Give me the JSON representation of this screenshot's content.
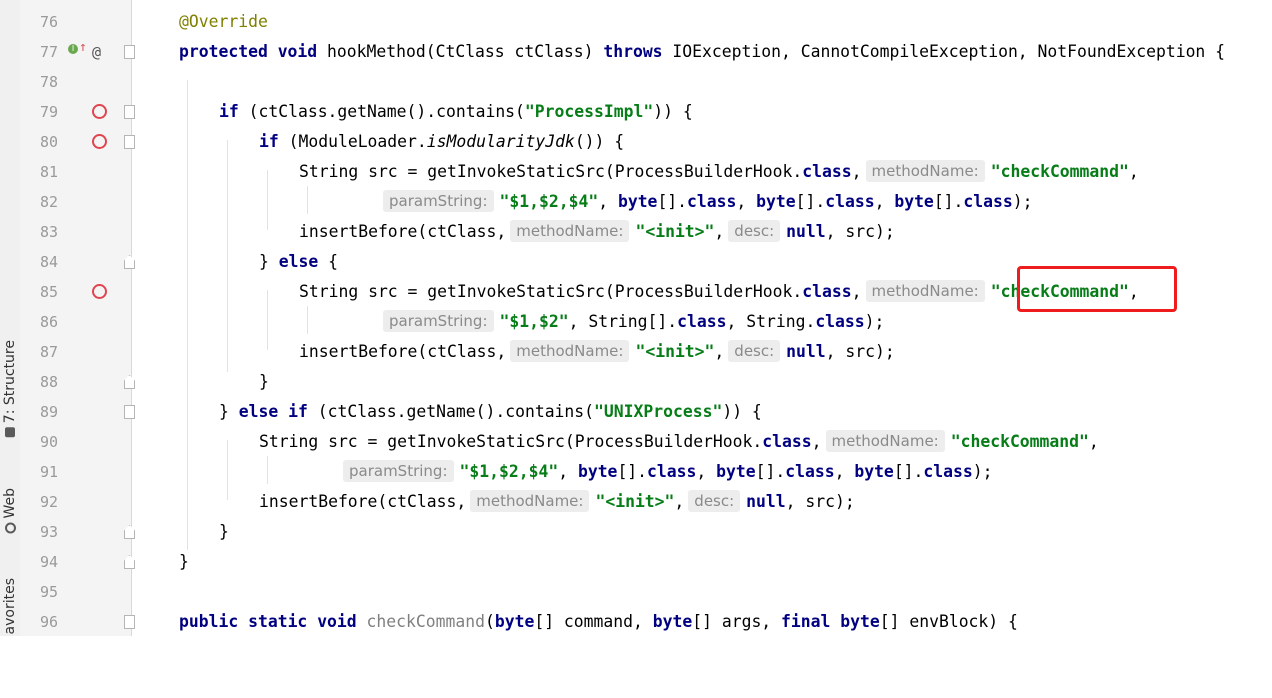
{
  "side_tabs": {
    "structure": "7: Structure",
    "web": "Web",
    "favorites": "avorites"
  },
  "lines": [
    {
      "num": "76"
    },
    {
      "num": "77"
    },
    {
      "num": "78"
    },
    {
      "num": "79"
    },
    {
      "num": "80"
    },
    {
      "num": "81"
    },
    {
      "num": "82"
    },
    {
      "num": "83"
    },
    {
      "num": "84"
    },
    {
      "num": "85"
    },
    {
      "num": "86"
    },
    {
      "num": "87"
    },
    {
      "num": "88"
    },
    {
      "num": "89"
    },
    {
      "num": "90"
    },
    {
      "num": "91"
    },
    {
      "num": "92"
    },
    {
      "num": "93"
    },
    {
      "num": "94"
    },
    {
      "num": "95"
    },
    {
      "num": "96"
    }
  ],
  "gutter_icons": {
    "override_marker": "I",
    "override_arrow": "↑",
    "at_sign": "@"
  },
  "code": {
    "l76": {
      "anno": "@Override"
    },
    "l77": {
      "kw1": "protected",
      "kw2": "void",
      "sig": " hookMethod(CtClass ctClass) ",
      "kw3": "throws",
      "rest": " IOException, CannotCompileException, NotFoundException {"
    },
    "l79": {
      "kw": "if",
      "a": " (ctClass.getName().contains(",
      "s": "\"ProcessImpl\"",
      "b": ")) {"
    },
    "l80": {
      "kw": "if",
      "a": " (ModuleLoader.",
      "i": "isModularityJdk",
      "b": "()) {"
    },
    "l81": {
      "a": "String src = getInvokeStaticSrc(ProcessBuilderHook.",
      "k": "class",
      "b": ",",
      "hint": "methodName:",
      "s": "\"checkCommand\"",
      "c": ","
    },
    "l82": {
      "hint": "paramString:",
      "s": "\"$1,$2,$4\"",
      "a": ", ",
      "k1": "byte",
      "b": "[].",
      "k2": "class",
      "c": ", ",
      "k3": "byte",
      "d": "[].",
      "k4": "class",
      "e": ", ",
      "k5": "byte",
      "f": "[].",
      "k6": "class",
      "g": ");"
    },
    "l83": {
      "a": "insertBefore(ctClass,",
      "hint1": "methodName:",
      "s": "\"<init>\"",
      "b": ",",
      "hint2": "desc:",
      "k": "null",
      "c": ", src);"
    },
    "l84": {
      "a": "} ",
      "kw": "else",
      "b": " {"
    },
    "l85": {
      "a": "String src = getInvokeStaticSrc(ProcessBuilderHook.",
      "k": "class",
      "b": ",",
      "hint": "methodName:",
      "s": "\"checkCommand\"",
      "c": ","
    },
    "l86": {
      "hint": "paramString:",
      "s": "\"$1,$2\"",
      "a": ", String[].",
      "k1": "class",
      "b": ", String.",
      "k2": "class",
      "c": ");"
    },
    "l87": {
      "a": "insertBefore(ctClass,",
      "hint1": "methodName:",
      "s": "\"<init>\"",
      "b": ",",
      "hint2": "desc:",
      "k": "null",
      "c": ", src);"
    },
    "l88": {
      "a": "}"
    },
    "l89": {
      "a": "} ",
      "kw1": "else",
      "sp": " ",
      "kw2": "if",
      "b": " (ctClass.getName().contains(",
      "s": "\"UNIXProcess\"",
      "c": ")) {"
    },
    "l90": {
      "a": "String src = getInvokeStaticSrc(ProcessBuilderHook.",
      "k": "class",
      "b": ",",
      "hint": "methodName:",
      "s": "\"checkCommand\"",
      "c": ","
    },
    "l91": {
      "hint": "paramString:",
      "s": "\"$1,$2,$4\"",
      "a": ", ",
      "k1": "byte",
      "b": "[].",
      "k2": "class",
      "c": ", ",
      "k3": "byte",
      "d": "[].",
      "k4": "class",
      "e": ", ",
      "k5": "byte",
      "f": "[].",
      "k6": "class",
      "g": ");"
    },
    "l92": {
      "a": "insertBefore(ctClass,",
      "hint1": "methodName:",
      "s": "\"<init>\"",
      "b": ",",
      "hint2": "desc:",
      "k": "null",
      "c": ", src);"
    },
    "l93": {
      "a": "}"
    },
    "l94": {
      "a": "}"
    },
    "l96": {
      "kw1": "public",
      "kw2": "static",
      "kw3": "void",
      "name": "checkCommand",
      "a": "(",
      "k1": "byte",
      "b": "[] command, ",
      "k2": "byte",
      "c": "[] args, ",
      "k3": "final",
      "d": " ",
      "k4": "byte",
      "e": "[] envBlock) {"
    }
  },
  "colors": {
    "keyword": "#000080",
    "string": "#067d17",
    "annotation": "#808000",
    "highlight_box": "#ee1c1c",
    "breakpoint": "#e0454f"
  }
}
